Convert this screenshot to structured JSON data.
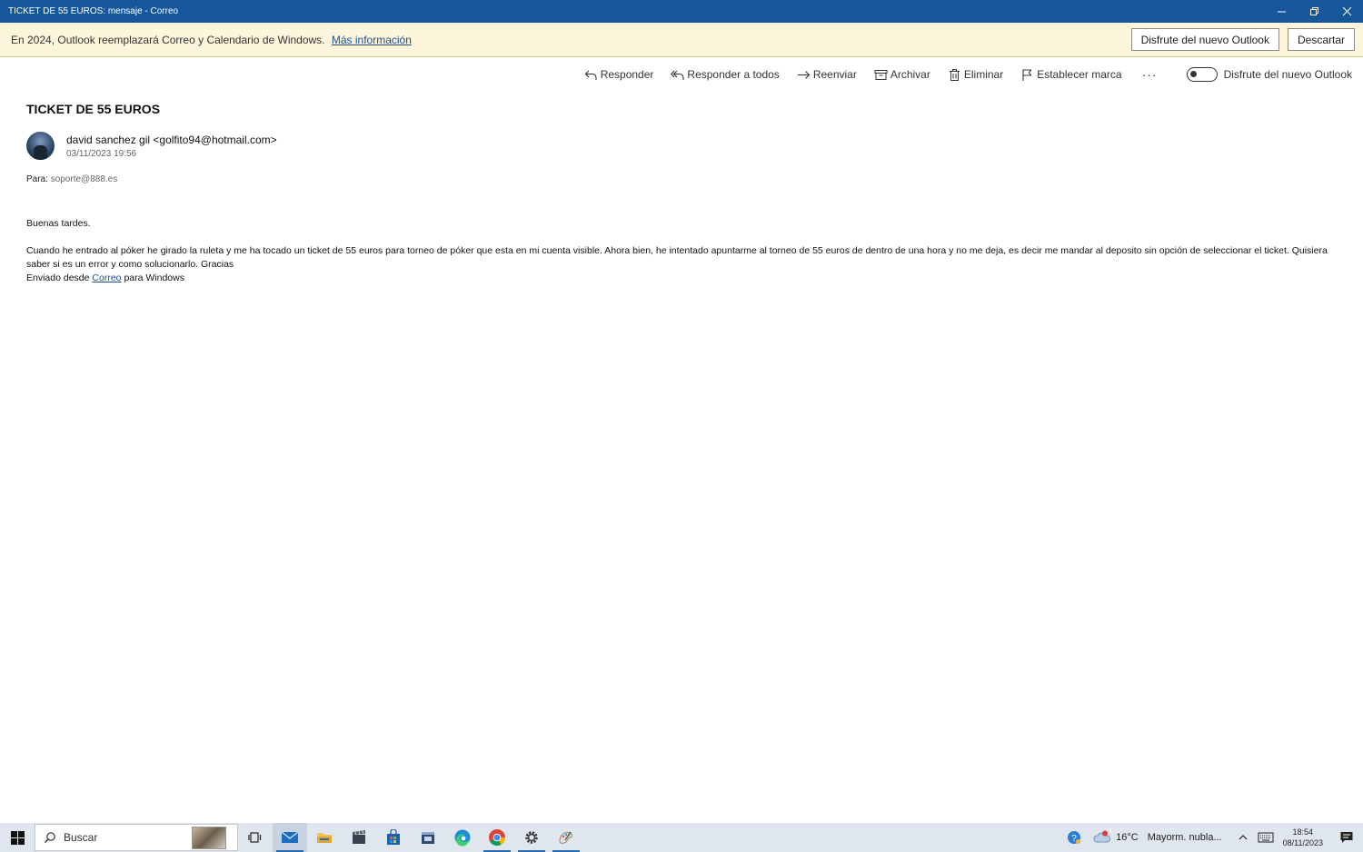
{
  "window": {
    "title": "TICKET DE 55 EUROS: mensaje - Correo"
  },
  "banner": {
    "message": "En 2024, Outlook reemplazará Correo y Calendario de Windows.",
    "link": "Más información",
    "button_try": "Disfrute del nuevo Outlook",
    "button_dismiss": "Descartar"
  },
  "toolbar": {
    "reply": "Responder",
    "reply_all": "Responder a todos",
    "forward": "Reenviar",
    "archive": "Archivar",
    "delete": "Eliminar",
    "flag": "Establecer marca",
    "more": "···",
    "toggle_label": "Disfrute del nuevo Outlook"
  },
  "message": {
    "subject": "TICKET DE 55 EUROS",
    "sender": "david sanchez gil <golfito94@hotmail.com>",
    "date": "03/11/2023 19:56",
    "to_label": "Para:",
    "to_address": "soporte@888.es",
    "greeting": "Buenas tardes.",
    "body": "Cuando he entrado al póker he girado la ruleta y me ha tocado un ticket de 55 euros para torneo de póker que esta en mi cuenta visible. Ahora bien, he intentado apuntarme al torneo de 55 euros de dentro de una hora y no me deja, es decir me mandar al deposito sin opción de seleccionar el ticket. Quisiera saber si es un error y como solucionarlo. Gracias",
    "signature_prefix": "Enviado desde",
    "signature_link": "Correo",
    "signature_suffix": "para Windows"
  },
  "taskbar": {
    "search_label": "Buscar",
    "weather_temp": "16°C",
    "weather_desc": "Mayorm. nubla...",
    "weather_badge": "1",
    "time": "18:54",
    "date": "08/11/2023"
  }
}
